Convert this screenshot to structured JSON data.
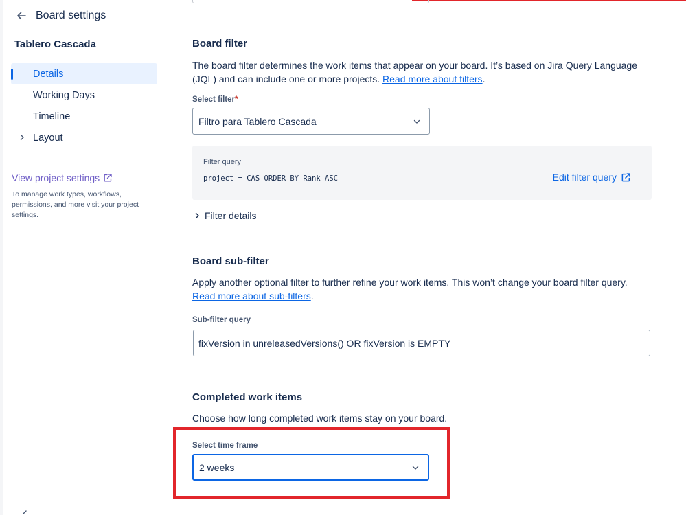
{
  "sidebar": {
    "back_title": "Board settings",
    "project_name": "Tablero Cascada",
    "items": [
      {
        "label": "Details",
        "active": true
      },
      {
        "label": "Working Days",
        "active": false
      },
      {
        "label": "Timeline",
        "active": false
      },
      {
        "label": "Layout",
        "active": false,
        "expandable": true
      }
    ],
    "view_project_label": "View project settings",
    "view_project_desc": "To manage work types, workflows, permissions, and more visit your project settings."
  },
  "board_filter": {
    "heading": "Board filter",
    "description": "The board filter determines the work items that appear on your board. It’s based on Jira Query Language (JQL) and can include one or more projects.",
    "read_more": "Read more about filters",
    "period": ".",
    "select_label": "Select filter",
    "required_mark": "*",
    "selected_filter": "Filtro para Tablero Cascada",
    "query_label": "Filter query",
    "query_code": "project = CAS ORDER BY Rank ASC",
    "edit_query": "Edit filter query",
    "filter_details": "Filter details"
  },
  "sub_filter": {
    "heading": "Board sub-filter",
    "description": "Apply another optional filter to further refine your work items. This won’t change your board filter query.",
    "read_more": "Read more about sub-filters",
    "period": ".",
    "query_label": "Sub-filter query",
    "query_value": "fixVersion in unreleasedVersions() OR fixVersion is EMPTY"
  },
  "completed": {
    "heading": "Completed work items",
    "description": "Choose how long completed work items stay on your board.",
    "select_label": "Select time frame",
    "selected_value": "2 weeks"
  },
  "colors": {
    "accent": "#0c66e4",
    "highlight": "#e2262b",
    "project_link": "#6e5dc6"
  }
}
